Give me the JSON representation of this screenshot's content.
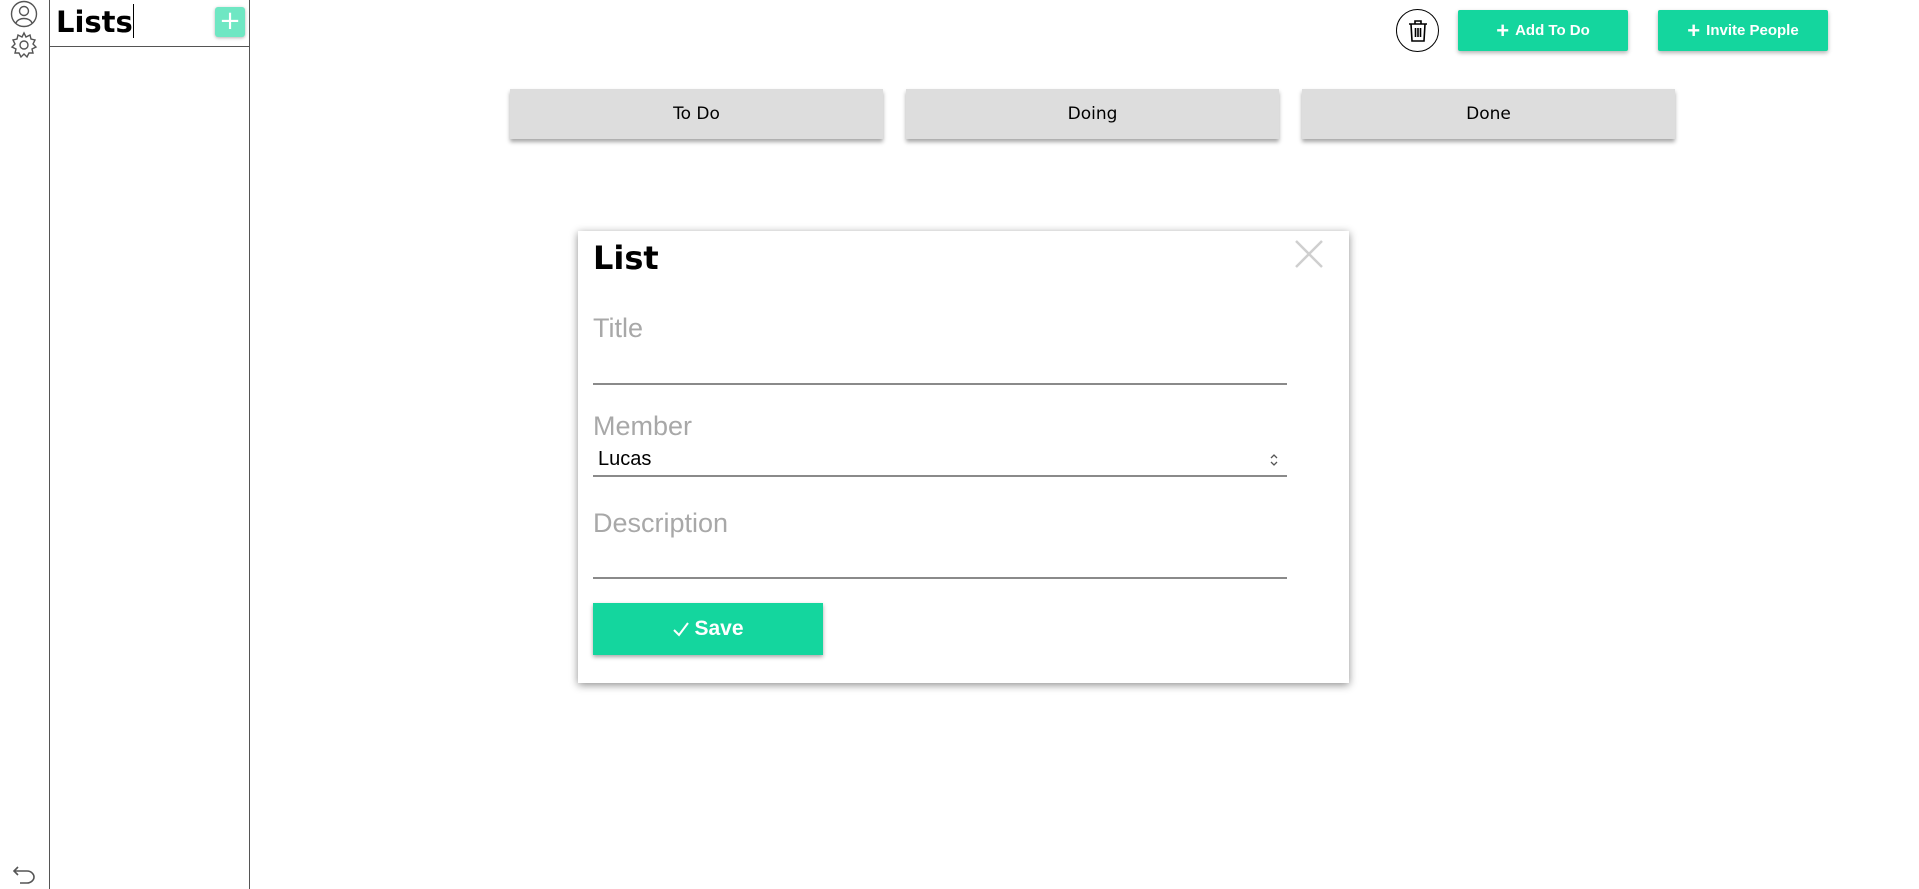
{
  "sidebar": {
    "icons": [
      "user-icon",
      "settings-icon",
      "undo-icon"
    ],
    "lists_title": "Lists",
    "add_label": "+"
  },
  "toolbar": {
    "trash_icon": "trash-icon",
    "add_todo_label": "Add To Do",
    "invite_label": "Invite People",
    "plus": "+"
  },
  "tabs": [
    {
      "label": "To Do"
    },
    {
      "label": "Doing"
    },
    {
      "label": "Done"
    }
  ],
  "modal": {
    "title": "List",
    "close_icon": "close-icon",
    "fields": {
      "title": {
        "label": "Title",
        "value": ""
      },
      "member": {
        "label": "Member",
        "selected": "Lucas"
      },
      "description": {
        "label": "Description",
        "value": ""
      }
    },
    "save_label": "Save"
  },
  "colors": {
    "accent": "#14d69e",
    "accent_light": "#6fe7c3",
    "tab_bg": "#dddddd",
    "label_gray": "#a8a8a8"
  }
}
